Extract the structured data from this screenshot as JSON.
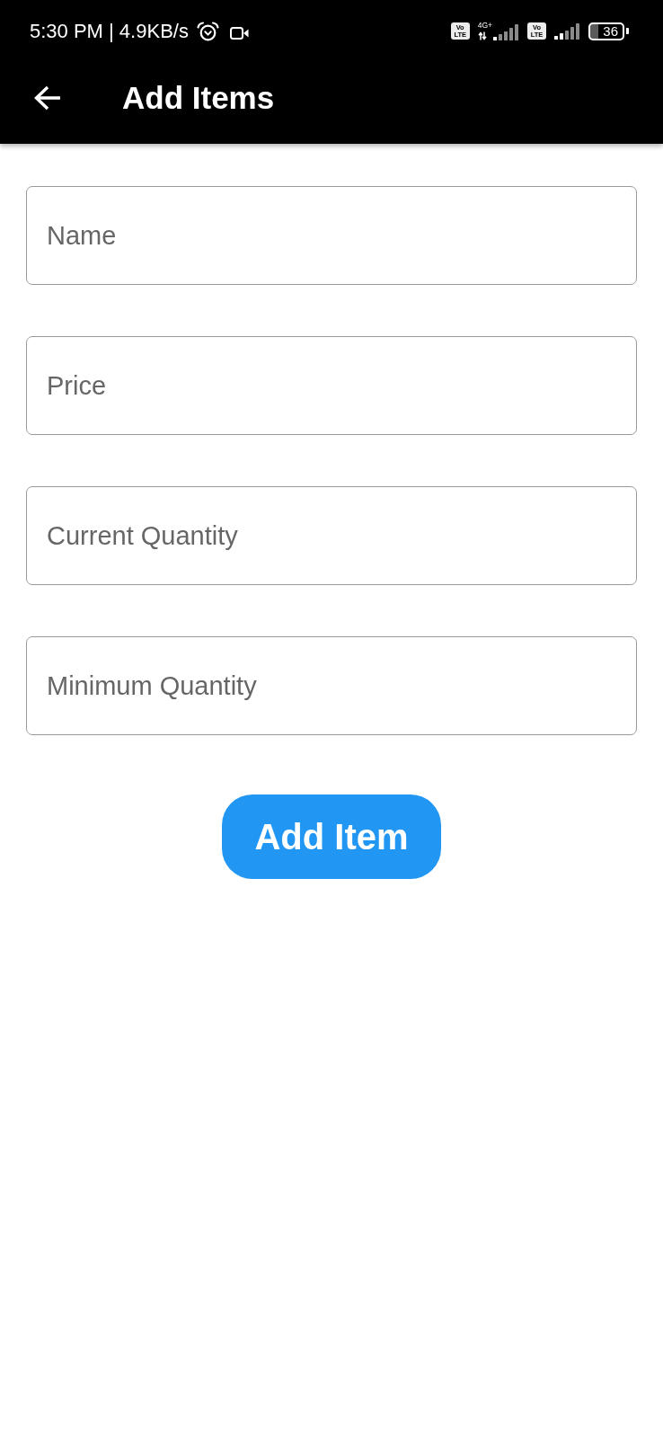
{
  "status_bar": {
    "text": "5:30 PM | 4.9KB/s",
    "sims": [
      {
        "badge": [
          "Vo",
          "LTE"
        ],
        "network": "4G+"
      },
      {
        "badge": [
          "Vo",
          "LTE"
        ]
      }
    ],
    "battery": "36"
  },
  "app_bar": {
    "title": "Add Items"
  },
  "form": {
    "fields": [
      {
        "placeholder": "Name"
      },
      {
        "placeholder": "Price"
      },
      {
        "placeholder": "Current Quantity"
      },
      {
        "placeholder": "Minimum Quantity"
      }
    ],
    "button": {
      "label": "Add Item"
    }
  }
}
